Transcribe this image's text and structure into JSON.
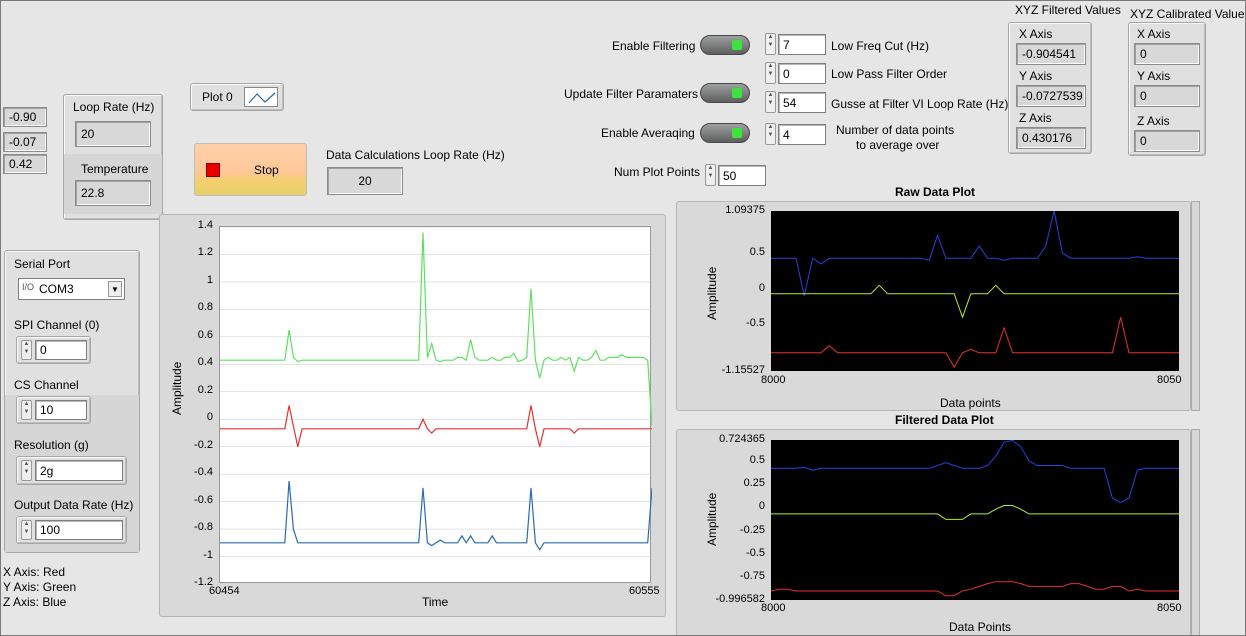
{
  "left_values": [
    "-0.90",
    "-0.07",
    "0.42"
  ],
  "loop_box": {
    "loop_rate_label": "Loop Rate (Hz)",
    "loop_rate_value": "20",
    "temperature_label": "Temperature",
    "temperature_value": "22.8"
  },
  "plot_legend": {
    "label": "Plot 0"
  },
  "stop_button": {
    "label": "Stop"
  },
  "data_calc": {
    "label": "Data Calculations Loop Rate (Hz)",
    "value": "20"
  },
  "filter_controls": {
    "enable_filtering": "Enable Filtering",
    "update_filter": "Update Filter Paramaters",
    "enable_averaging": "Enable Averaqing",
    "num_plot_points_label": "Num Plot Points",
    "num_plot_points": "50",
    "low_freq_cut_label": "Low Freq Cut (Hz)",
    "low_freq_cut": "7",
    "low_pass_order_label": "Low Pass Filter Order",
    "low_pass_order": "0",
    "gusse_label": "Gusse at Filter VI Loop Rate (Hz)",
    "gusse_value": "54",
    "avg_points_label_1": "Number of data points",
    "avg_points_label_2": "to average over",
    "avg_points": "4"
  },
  "xyz_filtered": {
    "title": "XYZ Filtered Values",
    "x_label": "X Axis",
    "x_value": "-0.904541",
    "y_label": "Y Axis",
    "y_value": "-0.0727539",
    "z_label": "Z Axis",
    "z_value": "0.430176"
  },
  "xyz_calibrated": {
    "title": "XYZ Calibrated Values",
    "x_label": "X Axis",
    "x_value": "0",
    "y_label": "Y Axis",
    "y_value": "0",
    "z_label": "Z Axis",
    "z_value": "0"
  },
  "serial_box": {
    "serial_port_label": "Serial Port",
    "serial_port_value": "COM3",
    "spi_label": "SPI Channel (0)",
    "spi_value": "0",
    "cs_label": "CS Channel",
    "cs_value": "10",
    "resolution_label": "Resolution (g)",
    "resolution_value": "2g",
    "odr_label": "Output Data Rate (Hz)",
    "odr_value": "100"
  },
  "axis_legend": [
    "X Axis: Red",
    "Y Axis: Green",
    "Z Axis: Blue"
  ],
  "colors": {
    "red": "#e53030",
    "green": "#5ee05e",
    "blue": "#2a6ab0",
    "raw_blue": "#2a40e0",
    "raw_yellow": "#b0f020"
  },
  "chart_data": [
    {
      "type": "line",
      "id": "main",
      "title": "",
      "xlabel": "Time",
      "ylabel": "Amplitude",
      "xlim": [
        60454,
        60555
      ],
      "ylim": [
        -1.2,
        1.4
      ],
      "x_ticks": [
        "60454",
        "60555"
      ],
      "y_ticks": [
        "1.4",
        "1.2",
        "1",
        "0.8",
        "0.6",
        "0.4",
        "0.2",
        "0",
        "-0.2",
        "-0.4",
        "-0.6",
        "-0.8",
        "-1",
        "-1.2"
      ],
      "series": [
        {
          "color": "#5ee05e",
          "values": [
            0.43,
            0.43,
            0.43,
            0.43,
            0.43,
            0.43,
            0.43,
            0.43,
            0.43,
            0.43,
            0.43,
            0.43,
            0.43,
            0.43,
            0.43,
            0.43,
            0.65,
            0.45,
            0.42,
            0.43,
            0.43,
            0.43,
            0.43,
            0.43,
            0.43,
            0.43,
            0.43,
            0.43,
            0.43,
            0.43,
            0.43,
            0.43,
            0.43,
            0.43,
            0.43,
            0.43,
            0.43,
            0.43,
            0.43,
            0.43,
            0.43,
            0.43,
            0.43,
            0.43,
            0.43,
            0.43,
            0.43,
            1.36,
            0.45,
            0.55,
            0.43,
            0.42,
            0.43,
            0.43,
            0.43,
            0.45,
            0.45,
            0.43,
            0.58,
            0.45,
            0.43,
            0.43,
            0.43,
            0.45,
            0.43,
            0.43,
            0.45,
            0.45,
            0.48,
            0.42,
            0.43,
            0.45,
            0.95,
            0.43,
            0.3,
            0.43,
            0.45,
            0.43,
            0.43,
            0.45,
            0.43,
            0.45,
            0.35,
            0.45,
            0.43,
            0.43,
            0.45,
            0.5,
            0.43,
            0.43,
            0.45,
            0.45,
            0.45,
            0.47,
            0.45,
            0.45,
            0.45,
            0.45,
            0.45,
            0.43,
            -0.05
          ]
        },
        {
          "color": "#e53030",
          "values": [
            -0.07,
            -0.07,
            -0.07,
            -0.07,
            -0.07,
            -0.07,
            -0.07,
            -0.07,
            -0.07,
            -0.07,
            -0.07,
            -0.07,
            -0.07,
            -0.07,
            -0.07,
            -0.07,
            0.1,
            -0.05,
            -0.2,
            -0.07,
            -0.07,
            -0.07,
            -0.07,
            -0.07,
            -0.07,
            -0.07,
            -0.07,
            -0.07,
            -0.07,
            -0.07,
            -0.07,
            -0.07,
            -0.07,
            -0.07,
            -0.07,
            -0.07,
            -0.07,
            -0.07,
            -0.07,
            -0.07,
            -0.07,
            -0.07,
            -0.07,
            -0.07,
            -0.07,
            -0.07,
            -0.07,
            0.0,
            -0.07,
            -0.1,
            -0.07,
            -0.07,
            -0.07,
            -0.07,
            -0.07,
            -0.07,
            -0.07,
            -0.07,
            -0.07,
            -0.07,
            -0.07,
            -0.07,
            -0.07,
            -0.07,
            -0.07,
            -0.07,
            -0.07,
            -0.07,
            -0.07,
            -0.07,
            -0.07,
            -0.07,
            0.1,
            -0.07,
            -0.2,
            -0.07,
            -0.07,
            -0.07,
            -0.07,
            -0.07,
            -0.07,
            -0.07,
            -0.1,
            -0.07,
            -0.07,
            -0.07,
            -0.07,
            -0.07,
            -0.07,
            -0.07,
            -0.07,
            -0.07,
            -0.07,
            -0.07,
            -0.07,
            -0.07,
            -0.07,
            -0.07,
            -0.07,
            -0.07,
            -0.07
          ]
        },
        {
          "color": "#2a6ab0",
          "values": [
            -0.9,
            -0.9,
            -0.9,
            -0.9,
            -0.9,
            -0.9,
            -0.9,
            -0.9,
            -0.9,
            -0.9,
            -0.9,
            -0.9,
            -0.9,
            -0.9,
            -0.9,
            -0.9,
            -0.45,
            -0.8,
            -0.9,
            -0.9,
            -0.9,
            -0.9,
            -0.9,
            -0.9,
            -0.9,
            -0.9,
            -0.9,
            -0.9,
            -0.9,
            -0.9,
            -0.9,
            -0.9,
            -0.9,
            -0.9,
            -0.9,
            -0.9,
            -0.9,
            -0.9,
            -0.9,
            -0.9,
            -0.9,
            -0.9,
            -0.9,
            -0.9,
            -0.9,
            -0.9,
            -0.9,
            -0.5,
            -0.9,
            -0.92,
            -0.9,
            -0.88,
            -0.9,
            -0.9,
            -0.9,
            -0.9,
            -0.85,
            -0.9,
            -0.85,
            -0.9,
            -0.9,
            -0.9,
            -0.9,
            -0.85,
            -0.9,
            -0.9,
            -0.9,
            -0.9,
            -0.9,
            -0.9,
            -0.9,
            -0.9,
            -0.5,
            -0.9,
            -0.95,
            -0.9,
            -0.9,
            -0.9,
            -0.9,
            -0.9,
            -0.9,
            -0.9,
            -0.9,
            -0.9,
            -0.9,
            -0.9,
            -0.9,
            -0.9,
            -0.9,
            -0.9,
            -0.9,
            -0.9,
            -0.9,
            -0.9,
            -0.9,
            -0.9,
            -0.9,
            -0.9,
            -0.9,
            -0.9,
            -0.5
          ]
        }
      ]
    },
    {
      "type": "line",
      "id": "raw",
      "title": "Raw Data Plot",
      "xlabel": "Data points",
      "ylabel": "Amplitude",
      "xlim": [
        8000,
        8050
      ],
      "ylim": [
        -1.15527,
        1.09375
      ],
      "x_ticks": [
        "8000",
        "8050"
      ],
      "y_ticks": [
        "1.09375",
        "0.5",
        "0",
        "-0.5",
        "-1.15527"
      ],
      "series": [
        {
          "color": "#2a40e0",
          "values": [
            0.43,
            0.43,
            0.43,
            0.43,
            -0.1,
            0.43,
            0.35,
            0.43,
            0.43,
            0.43,
            0.43,
            0.43,
            0.43,
            0.43,
            0.43,
            0.43,
            0.43,
            0.43,
            0.43,
            0.4,
            0.75,
            0.43,
            0.43,
            0.43,
            0.43,
            0.6,
            0.43,
            0.43,
            0.4,
            0.43,
            0.43,
            0.43,
            0.43,
            0.6,
            1.1,
            0.5,
            0.43,
            0.43,
            0.43,
            0.43,
            0.43,
            0.43,
            0.43,
            0.43,
            0.45,
            0.43,
            0.43,
            0.43,
            0.43,
            0.43
          ]
        },
        {
          "color": "#b0f020",
          "values": [
            -0.07,
            -0.07,
            -0.07,
            -0.07,
            -0.07,
            -0.07,
            -0.07,
            -0.07,
            -0.07,
            -0.07,
            -0.07,
            -0.07,
            -0.07,
            0.05,
            -0.07,
            -0.07,
            -0.07,
            -0.07,
            -0.07,
            -0.07,
            -0.07,
            -0.07,
            -0.07,
            -0.4,
            -0.07,
            -0.07,
            -0.07,
            0.05,
            -0.07,
            -0.07,
            -0.07,
            -0.07,
            -0.07,
            -0.07,
            -0.07,
            -0.07,
            -0.07,
            -0.07,
            -0.07,
            -0.07,
            -0.07,
            -0.07,
            -0.07,
            -0.07,
            -0.07,
            -0.07,
            -0.07,
            -0.07,
            -0.07,
            -0.07
          ]
        },
        {
          "color": "#e53030",
          "values": [
            -0.9,
            -0.9,
            -0.9,
            -0.9,
            -0.9,
            -0.9,
            -0.9,
            -0.8,
            -0.9,
            -0.9,
            -0.9,
            -0.9,
            -0.9,
            -0.9,
            -0.9,
            -0.9,
            -0.9,
            -0.9,
            -0.9,
            -0.9,
            -0.9,
            -0.9,
            -1.1,
            -0.9,
            -0.85,
            -0.9,
            -0.9,
            -0.9,
            -0.55,
            -0.9,
            -0.9,
            -0.9,
            -0.9,
            -0.9,
            -0.9,
            -0.9,
            -0.9,
            -0.9,
            -0.9,
            -0.9,
            -0.9,
            -0.9,
            -0.4,
            -0.9,
            -0.9,
            -0.9,
            -0.9,
            -0.9,
            -0.9,
            -0.9
          ]
        }
      ]
    },
    {
      "type": "line",
      "id": "filtered",
      "title": "Filtered Data Plot",
      "xlabel": "Data Points",
      "ylabel": "Amplitude",
      "xlim": [
        8000,
        8050
      ],
      "ylim": [
        -0.996582,
        0.724365
      ],
      "x_ticks": [
        "8000",
        "8050"
      ],
      "y_ticks": [
        "0.724365",
        "0.5",
        "0.25",
        "0",
        "-0.25",
        "-0.5",
        "-0.75",
        "-0.996582"
      ],
      "series": [
        {
          "color": "#2a40e0",
          "values": [
            0.42,
            0.42,
            0.42,
            0.42,
            0.43,
            0.4,
            0.42,
            0.42,
            0.42,
            0.42,
            0.42,
            0.42,
            0.42,
            0.42,
            0.42,
            0.42,
            0.42,
            0.42,
            0.42,
            0.42,
            0.45,
            0.48,
            0.45,
            0.42,
            0.42,
            0.42,
            0.45,
            0.55,
            0.7,
            0.72,
            0.65,
            0.5,
            0.45,
            0.45,
            0.45,
            0.45,
            0.42,
            0.42,
            0.42,
            0.42,
            0.42,
            0.1,
            0.05,
            0.1,
            0.4,
            0.42,
            0.42,
            0.42,
            0.42,
            0.42
          ]
        },
        {
          "color": "#b0f020",
          "values": [
            -0.07,
            -0.07,
            -0.07,
            -0.07,
            -0.07,
            -0.07,
            -0.07,
            -0.07,
            -0.07,
            -0.07,
            -0.07,
            -0.07,
            -0.07,
            -0.07,
            -0.07,
            -0.07,
            -0.07,
            -0.07,
            -0.07,
            -0.07,
            -0.07,
            -0.13,
            -0.13,
            -0.13,
            -0.07,
            -0.07,
            -0.07,
            -0.02,
            0.02,
            0.02,
            -0.02,
            -0.07,
            -0.07,
            -0.07,
            -0.07,
            -0.07,
            -0.07,
            -0.07,
            -0.07,
            -0.07,
            -0.07,
            -0.07,
            -0.07,
            -0.07,
            -0.07,
            -0.07,
            -0.07,
            -0.07,
            -0.07,
            -0.07
          ]
        },
        {
          "color": "#e53030",
          "values": [
            -0.9,
            -0.88,
            -0.88,
            -0.9,
            -0.9,
            -0.9,
            -0.9,
            -0.9,
            -0.9,
            -0.9,
            -0.9,
            -0.9,
            -0.9,
            -0.9,
            -0.9,
            -0.9,
            -0.9,
            -0.9,
            -0.9,
            -0.9,
            -0.9,
            -0.95,
            -0.95,
            -0.9,
            -0.88,
            -0.85,
            -0.82,
            -0.8,
            -0.8,
            -0.8,
            -0.82,
            -0.85,
            -0.85,
            -0.85,
            -0.85,
            -0.85,
            -0.82,
            -0.82,
            -0.85,
            -0.88,
            -0.88,
            -0.85,
            -0.85,
            -0.9,
            -0.88,
            -0.9,
            -0.9,
            -0.9,
            -0.9,
            -0.9
          ]
        }
      ]
    }
  ]
}
